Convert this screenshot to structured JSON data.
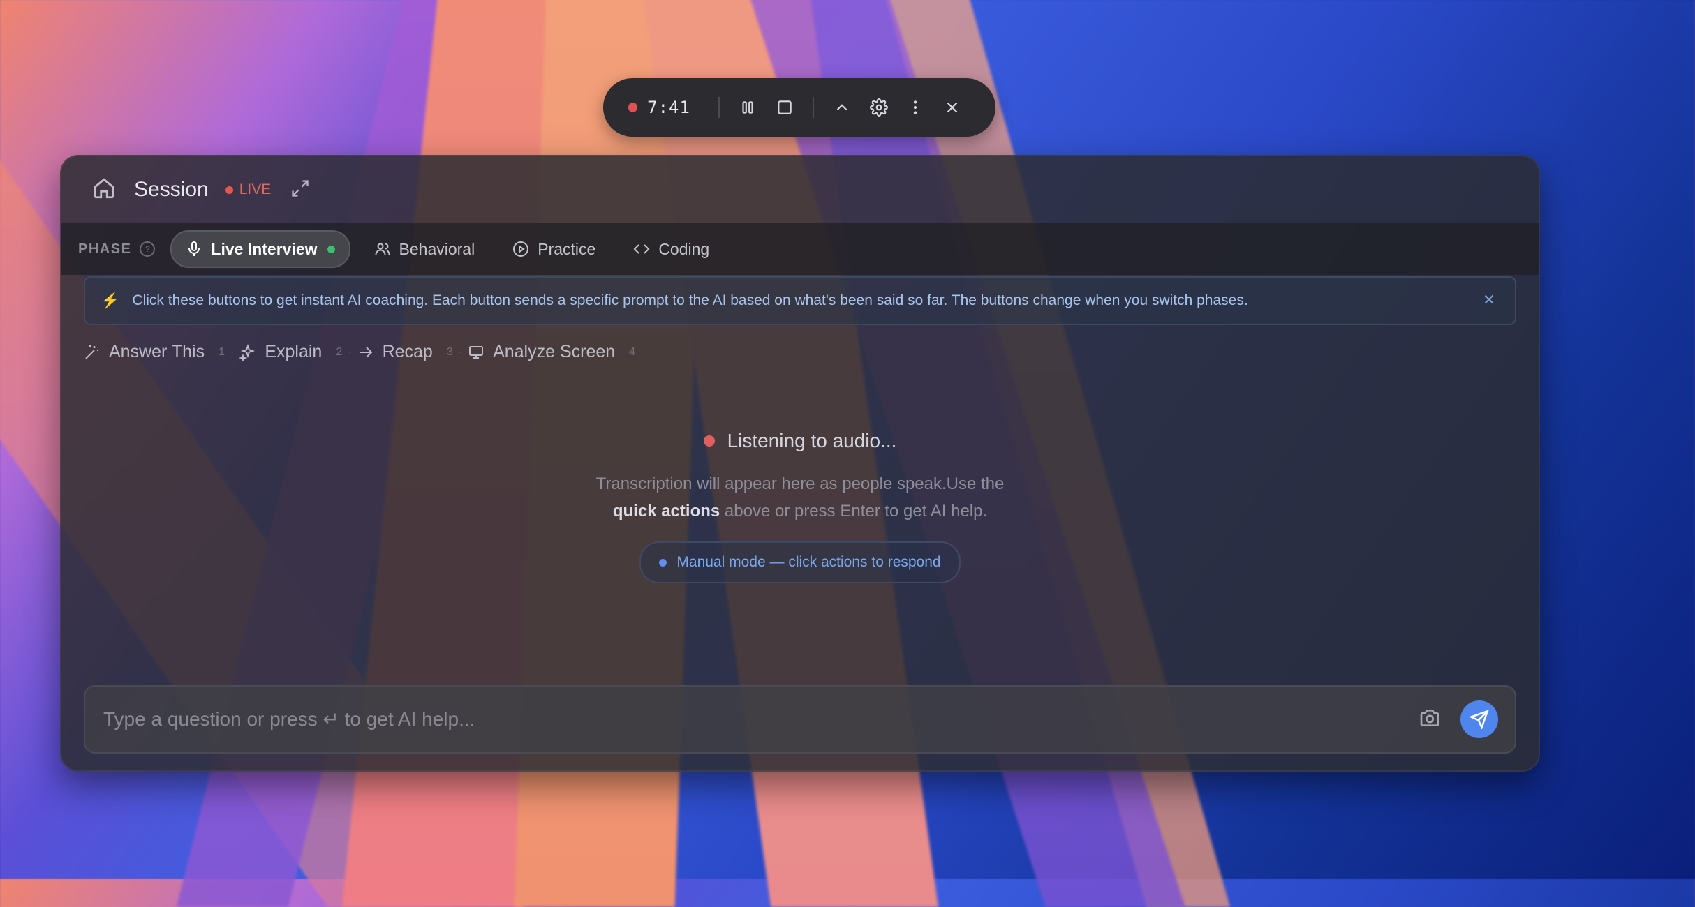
{
  "colors": {
    "accent": "#4f86ee",
    "live": "#e06a62",
    "active_dot": "#38c070",
    "info_text": "#a8c4ec"
  },
  "controls": {
    "timer": "7:41",
    "icons": [
      "record-dot-icon",
      "pause-icon",
      "stop-icon",
      "chevron-up-icon",
      "gear-icon",
      "more-vertical-icon",
      "close-icon"
    ]
  },
  "header": {
    "title": "Session",
    "live_label": "LIVE"
  },
  "phase": {
    "label": "PHASE",
    "tabs": [
      {
        "label": "Live Interview",
        "icon": "mic-icon",
        "active": true
      },
      {
        "label": "Behavioral",
        "icon": "users-icon",
        "active": false
      },
      {
        "label": "Practice",
        "icon": "play-circle-icon",
        "active": false
      },
      {
        "label": "Coding",
        "icon": "code-icon",
        "active": false
      }
    ]
  },
  "info_banner": {
    "text": "Click these buttons to get instant AI coaching. Each button sends a specific prompt to the AI based on what's been said so far. The buttons change when you switch phases."
  },
  "quick_actions": [
    {
      "label": "Answer This",
      "shortcut": "1",
      "icon": "magic-wand-icon"
    },
    {
      "label": "Explain",
      "shortcut": "2",
      "icon": "sparkles-icon"
    },
    {
      "label": "Recap",
      "shortcut": "3",
      "icon": "arrow-right-icon"
    },
    {
      "label": "Analyze Screen",
      "shortcut": "4",
      "icon": "monitor-icon"
    }
  ],
  "status": {
    "listening": "Listening to audio...",
    "desc_part1": "Transcription will appear here as people speak.Use the ",
    "desc_bold": "quick actions",
    "desc_part2": " above or press Enter to get AI help.",
    "mode_badge": "Manual mode — click actions to respond"
  },
  "input": {
    "placeholder": "Type a question or press ↵ to get AI help..."
  }
}
